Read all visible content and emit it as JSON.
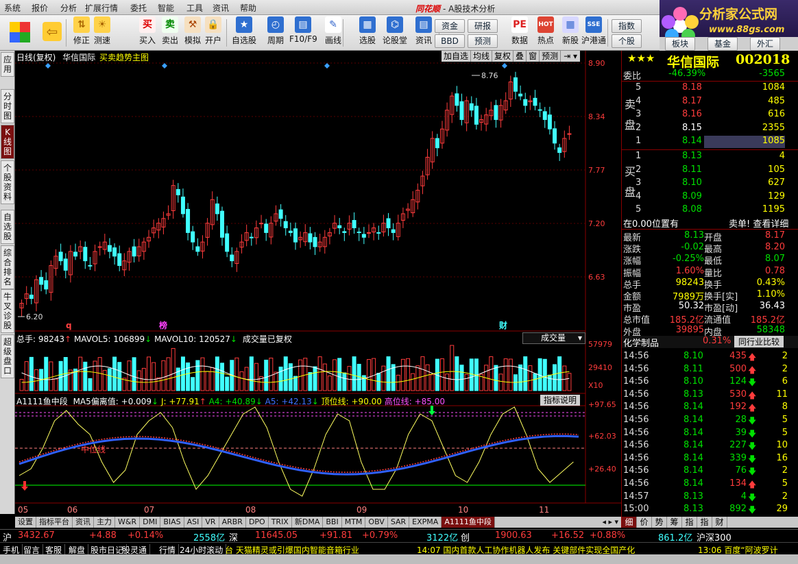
{
  "menu": [
    "系统",
    "报价",
    "分析",
    "扩展行情",
    "委托",
    "智能",
    "工具",
    "资讯",
    "帮助"
  ],
  "app": {
    "brand": "同花顺",
    "title": "- A股技术分析",
    "logo_main": "分析家公式网",
    "logo_url": "www.88gs.com"
  },
  "toolbar": [
    {
      "label": "修正",
      "icon": "up-down-arrows-icon"
    },
    {
      "label": "测速",
      "icon": "stopwatch-icon"
    },
    {
      "label": "买入",
      "icon": "buy-icon",
      "glyph": "买"
    },
    {
      "label": "卖出",
      "icon": "sell-icon",
      "glyph": "卖"
    },
    {
      "label": "模拟",
      "icon": "gavel-icon"
    },
    {
      "label": "开户",
      "icon": "lock-icon"
    },
    {
      "label": "自选股",
      "icon": "star-icon"
    },
    {
      "label": "周期",
      "icon": "clock-icon"
    },
    {
      "label": "F10/F9",
      "icon": "info-icon"
    },
    {
      "label": "画线",
      "icon": "pencil-icon"
    },
    {
      "label": "选股",
      "icon": "screen-icon"
    },
    {
      "label": "论股堂",
      "icon": "talk-icon"
    },
    {
      "label": "资讯",
      "icon": "news-icon"
    },
    {
      "label": "数据",
      "icon": "pe-icon",
      "glyph": "PE"
    },
    {
      "label": "热点",
      "icon": "hot-icon",
      "glyph": "HOT"
    },
    {
      "label": "新股",
      "icon": "ipo-icon"
    },
    {
      "label": "沪港通",
      "icon": "hk-icon",
      "glyph": "SSE"
    }
  ],
  "toolbar_buttons": [
    "资金",
    "研报",
    "BBD",
    "预测",
    "指数",
    "个股",
    "板块",
    "基金",
    "外汇"
  ],
  "sidetabs": [
    "应用",
    "分时图",
    "K线图",
    "个股资料",
    "自选股",
    "综合排名",
    "牛叉诊股",
    "超级盘口"
  ],
  "chart": {
    "header": "日线(复权)",
    "stock": "华信国际",
    "formula": "买卖趋势主图",
    "buttons": [
      "加自选",
      "均线",
      "复权",
      "叠",
      "窗",
      "预测"
    ],
    "price_ticks": [
      "8.90",
      "8.34",
      "7.77",
      "7.20",
      "6.63"
    ],
    "high_label": "8.76",
    "low_label": "6.20",
    "markers": [
      {
        "text": "q",
        "color": "#ff4040"
      },
      {
        "text": "榜",
        "color": "#ff40ff"
      },
      {
        "text": "财",
        "color": "#40ffff"
      }
    ],
    "vol_header": {
      "total": "总手: 98243",
      "mavol5": "MAVOL5: 106899",
      "mavol10": "MAVOL10: 120527",
      "note": "成交量已复权",
      "sel": "成交量"
    },
    "vol_ticks": [
      "57979",
      "29410",
      "X10"
    ],
    "ind_header": {
      "name": "A1111鱼中段",
      "ma5": "MA5偏离值: +0.009",
      "j": "J: +77.91",
      "a4": "A4: +40.89",
      "a5": "A5: +42.13",
      "top": "顶位线: +90.00",
      "high": "高位线: +85.00",
      "btn": "指标说明"
    },
    "ind_ticks": [
      "+97.65",
      "+62.03",
      "+26.40"
    ],
    "mid_label": "中位线",
    "months": [
      "05",
      "06",
      "07",
      "08",
      "09",
      "10",
      "11"
    ]
  },
  "bottom_tabs": [
    "设置",
    "指标平台",
    "资讯",
    "主力",
    "W&R",
    "DMI",
    "BIAS",
    "ASI",
    "VR",
    "ARBR",
    "DPO",
    "TRIX",
    "新DMA",
    "BBI",
    "MTM",
    "OBV",
    "SAR",
    "EXPMA",
    "A1111鱼中段"
  ],
  "quote": {
    "name": "华信国际",
    "code": "002018",
    "stars": "★★★",
    "webi_label": "委比",
    "webi": "-46.39%",
    "webi_diff": "-3565",
    "sell_label": "卖盘",
    "buy_label": "买盘",
    "sells": [
      {
        "lvl": "5",
        "p": "8.18",
        "v": "1084"
      },
      {
        "lvl": "4",
        "p": "8.17",
        "v": "485"
      },
      {
        "lvl": "3",
        "p": "8.16",
        "v": "616"
      },
      {
        "lvl": "2",
        "p": "8.15",
        "v": "2355"
      },
      {
        "lvl": "1",
        "p": "8.14",
        "v": "1085"
      }
    ],
    "buys": [
      {
        "lvl": "1",
        "p": "8.13",
        "v": "4"
      },
      {
        "lvl": "2",
        "p": "8.11",
        "v": "105"
      },
      {
        "lvl": "3",
        "p": "8.10",
        "v": "627"
      },
      {
        "lvl": "4",
        "p": "8.09",
        "v": "129"
      },
      {
        "lvl": "5",
        "p": "8.08",
        "v": "1195"
      }
    ],
    "pos_text": "在0.00位置有",
    "pos_link": "卖单! 查看详细",
    "stats": [
      [
        "最新",
        "8.13",
        "开盘",
        "8.17"
      ],
      [
        "涨跌",
        "-0.02",
        "最高",
        "8.20"
      ],
      [
        "涨幅",
        "-0.25%",
        "最低",
        "8.07"
      ],
      [
        "振幅",
        "1.60%",
        "量比",
        "0.78"
      ],
      [
        "总手",
        "98243",
        "换手",
        "0.43%"
      ],
      [
        "金额",
        "7989万",
        "换手[实]",
        "1.10%"
      ],
      [
        "市盈",
        "50.32",
        "市盈[动]",
        "36.43"
      ],
      [
        "总市值",
        "185.2亿",
        "流通值",
        "185.2亿"
      ],
      [
        "外盘",
        "39895",
        "内盘",
        "58348"
      ]
    ],
    "sector": "化学制品",
    "sector_pct": "0.31%",
    "sector_btn": "同行业比较",
    "ticks": [
      [
        "14:56",
        "8.10",
        "435",
        "up",
        "2"
      ],
      [
        "14:56",
        "8.11",
        "500",
        "up",
        "2"
      ],
      [
        "14:56",
        "8.10",
        "124",
        "down",
        "6"
      ],
      [
        "14:56",
        "8.13",
        "530",
        "up",
        "11"
      ],
      [
        "14:56",
        "8.14",
        "192",
        "up",
        "8"
      ],
      [
        "14:56",
        "8.14",
        "28",
        "down",
        "5"
      ],
      [
        "14:56",
        "8.14",
        "39",
        "down",
        "5"
      ],
      [
        "14:56",
        "8.14",
        "227",
        "down",
        "10"
      ],
      [
        "14:56",
        "8.14",
        "339",
        "down",
        "16"
      ],
      [
        "14:56",
        "8.14",
        "76",
        "down",
        "2"
      ],
      [
        "14:56",
        "8.14",
        "134",
        "up",
        "5"
      ],
      [
        "14:57",
        "8.13",
        "4",
        "down",
        "2"
      ],
      [
        "15:00",
        "8.13",
        "892",
        "down",
        "29"
      ]
    ],
    "tabs": [
      "细",
      "价",
      "势",
      "筹",
      "指",
      "指",
      "财"
    ]
  },
  "status": {
    "sh_label": "沪",
    "sh": "3432.67",
    "sh_chg": "+4.88",
    "sh_pct": "+0.14%",
    "sh_amt": "2558亿",
    "sz_label": "深",
    "sz": "11645.05",
    "sz_chg": "+91.81",
    "sz_pct": "+0.79%",
    "sz_amt": "3122亿",
    "cy_label": "创",
    "cy": "1900.63",
    "cy_chg": "+16.52",
    "cy_pct": "+0.88%",
    "hs_amt": "861.2亿",
    "hs_label": "沪深300"
  },
  "status2": {
    "items": [
      "手机",
      "留言",
      "客服",
      "解盘",
      "股市日记",
      "股灵通",
      "行情",
      "24小时滚动"
    ],
    "news1": "台 天猫精灵或引爆国内智能音箱行业",
    "news2": "14:07 国内首款人工协作机器人发布 关键部件实现全国产化",
    "news3": "13:06 百度“阿波罗计"
  },
  "colors": {
    "up": "#ff3c3c",
    "down": "#00e000",
    "cyan": "#40ffff",
    "yellow": "#ffff00",
    "border": "#8a0000"
  }
}
